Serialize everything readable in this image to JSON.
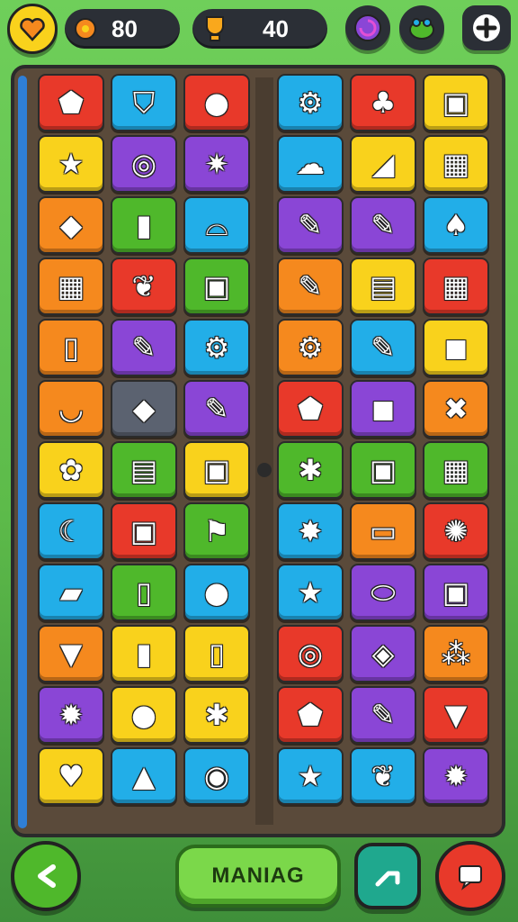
{
  "topbar": {
    "coins": {
      "value": "80",
      "icon": "gear-coin-icon"
    },
    "gems": {
      "value": "40",
      "icon": "trophy-icon"
    },
    "left_icon": "heart-icon",
    "right_icons": [
      "swirl-icon",
      "frog-icon",
      "plus-icon"
    ]
  },
  "colors": {
    "red": "#e8392a",
    "orange": "#f5891e",
    "yellow": "#f9d21c",
    "green": "#4fb82b",
    "blue": "#22aee8",
    "purple": "#8a46d6",
    "gray": "#5b6270",
    "lime": "#93d52e"
  },
  "left_grid": [
    {
      "color": "red",
      "icon": "tag-icon",
      "glyph": "⬟"
    },
    {
      "color": "blue",
      "icon": "shield-icon",
      "glyph": "⛉"
    },
    {
      "color": "red",
      "icon": "apple-icon",
      "glyph": "●"
    },
    {
      "color": "yellow",
      "icon": "star-icon",
      "glyph": "★"
    },
    {
      "color": "purple",
      "icon": "target-icon",
      "glyph": "◎"
    },
    {
      "color": "purple",
      "icon": "burst-icon",
      "glyph": "✷"
    },
    {
      "color": "orange",
      "icon": "ticket-icon",
      "glyph": "◆"
    },
    {
      "color": "green",
      "icon": "crayon-icon",
      "glyph": "▮"
    },
    {
      "color": "blue",
      "icon": "hat-icon",
      "glyph": "⌓"
    },
    {
      "color": "orange",
      "icon": "calculator-icon",
      "glyph": "▦"
    },
    {
      "color": "red",
      "icon": "leaf-icon",
      "glyph": "❦"
    },
    {
      "color": "green",
      "icon": "bag-icon",
      "glyph": "▣"
    },
    {
      "color": "orange",
      "icon": "bottle-icon",
      "glyph": "▯"
    },
    {
      "color": "purple",
      "icon": "pencil-icon",
      "glyph": "✎"
    },
    {
      "color": "blue",
      "icon": "gear-icon",
      "glyph": "⚙"
    },
    {
      "color": "orange",
      "icon": "bowl-icon",
      "glyph": "◡"
    },
    {
      "color": "gray",
      "icon": "gem-icon",
      "glyph": "◆"
    },
    {
      "color": "purple",
      "icon": "crayon-icon",
      "glyph": "✎"
    },
    {
      "color": "yellow",
      "icon": "flower-icon",
      "glyph": "✿"
    },
    {
      "color": "green",
      "icon": "toolbox-icon",
      "glyph": "▤"
    },
    {
      "color": "yellow",
      "icon": "briefcase-icon",
      "glyph": "▣"
    },
    {
      "color": "blue",
      "icon": "croissant-icon",
      "glyph": "☾"
    },
    {
      "color": "red",
      "icon": "box-icon",
      "glyph": "▣"
    },
    {
      "color": "green",
      "icon": "axe-icon",
      "glyph": "⚑"
    },
    {
      "color": "blue",
      "icon": "eraser-icon",
      "glyph": "▰"
    },
    {
      "color": "green",
      "icon": "jar-icon",
      "glyph": "▯"
    },
    {
      "color": "blue",
      "icon": "tomato-icon",
      "glyph": "●"
    },
    {
      "color": "orange",
      "icon": "icecream-icon",
      "glyph": "▼"
    },
    {
      "color": "yellow",
      "icon": "popsicle-icon",
      "glyph": "▮"
    },
    {
      "color": "yellow",
      "icon": "bottle-icon",
      "glyph": "▯"
    },
    {
      "color": "purple",
      "icon": "sun-icon",
      "glyph": "✹"
    },
    {
      "color": "yellow",
      "icon": "orange-fruit-icon",
      "glyph": "●"
    },
    {
      "color": "yellow",
      "icon": "bug-icon",
      "glyph": "✱"
    },
    {
      "color": "yellow",
      "icon": "lips-icon",
      "glyph": "♥"
    },
    {
      "color": "blue",
      "icon": "triangle-icon",
      "glyph": "▲"
    },
    {
      "color": "blue",
      "icon": "donut-icon",
      "glyph": "◉"
    }
  ],
  "right_grid": [
    {
      "color": "blue",
      "icon": "gear-icon",
      "glyph": "⚙"
    },
    {
      "color": "red",
      "icon": "cactus-icon",
      "glyph": "♣"
    },
    {
      "color": "yellow",
      "icon": "jar-icon",
      "glyph": "▣"
    },
    {
      "color": "blue",
      "icon": "cloud-icon",
      "glyph": "☁"
    },
    {
      "color": "yellow",
      "icon": "cheese-icon",
      "glyph": "◢"
    },
    {
      "color": "yellow",
      "icon": "camera-icon",
      "glyph": "▦"
    },
    {
      "color": "purple",
      "icon": "crayon-icon",
      "glyph": "✎"
    },
    {
      "color": "purple",
      "icon": "pencil-icon",
      "glyph": "✎"
    },
    {
      "color": "blue",
      "icon": "bird-icon",
      "glyph": "♠"
    },
    {
      "color": "orange",
      "icon": "crayon-icon",
      "glyph": "✎"
    },
    {
      "color": "yellow",
      "icon": "book-icon",
      "glyph": "▤"
    },
    {
      "color": "red",
      "icon": "calendar-icon",
      "glyph": "▦"
    },
    {
      "color": "orange",
      "icon": "gear-icon",
      "glyph": "⚙"
    },
    {
      "color": "blue",
      "icon": "pencil-icon",
      "glyph": "✎"
    },
    {
      "color": "yellow",
      "icon": "square-icon",
      "glyph": "◼"
    },
    {
      "color": "red",
      "icon": "pentagon-icon",
      "glyph": "⬟"
    },
    {
      "color": "purple",
      "icon": "cube-icon",
      "glyph": "◼"
    },
    {
      "color": "orange",
      "icon": "tools-icon",
      "glyph": "✖"
    },
    {
      "color": "green",
      "icon": "turtle-icon",
      "glyph": "✱"
    },
    {
      "color": "green",
      "icon": "radio-icon",
      "glyph": "▣"
    },
    {
      "color": "green",
      "icon": "calculator-icon",
      "glyph": "▦"
    },
    {
      "color": "blue",
      "icon": "splat-icon",
      "glyph": "✸"
    },
    {
      "color": "orange",
      "icon": "cup-icon",
      "glyph": "▭"
    },
    {
      "color": "red",
      "icon": "virus-icon",
      "glyph": "✺"
    },
    {
      "color": "blue",
      "icon": "star-icon",
      "glyph": "★"
    },
    {
      "color": "purple",
      "icon": "bread-icon",
      "glyph": "⬭"
    },
    {
      "color": "purple",
      "icon": "radio-icon",
      "glyph": "▣"
    },
    {
      "color": "red",
      "icon": "donut-icon",
      "glyph": "◎"
    },
    {
      "color": "purple",
      "icon": "diamond-icon",
      "glyph": "◈"
    },
    {
      "color": "orange",
      "icon": "molecule-icon",
      "glyph": "⁂"
    },
    {
      "color": "red",
      "icon": "pentagon-icon",
      "glyph": "⬟"
    },
    {
      "color": "purple",
      "icon": "pencil-icon",
      "glyph": "✎"
    },
    {
      "color": "red",
      "icon": "triangle-icon",
      "glyph": "▼"
    },
    {
      "color": "blue",
      "icon": "star-icon",
      "glyph": "★"
    },
    {
      "color": "blue",
      "icon": "leaf-icon",
      "glyph": "❦"
    },
    {
      "color": "purple",
      "icon": "sun-icon",
      "glyph": "✹"
    }
  ],
  "bottombar": {
    "manage_label": "MANIAG",
    "back_icon": "back-arrow-icon",
    "share_icon": "share-icon",
    "chat_icon": "chat-icon"
  }
}
